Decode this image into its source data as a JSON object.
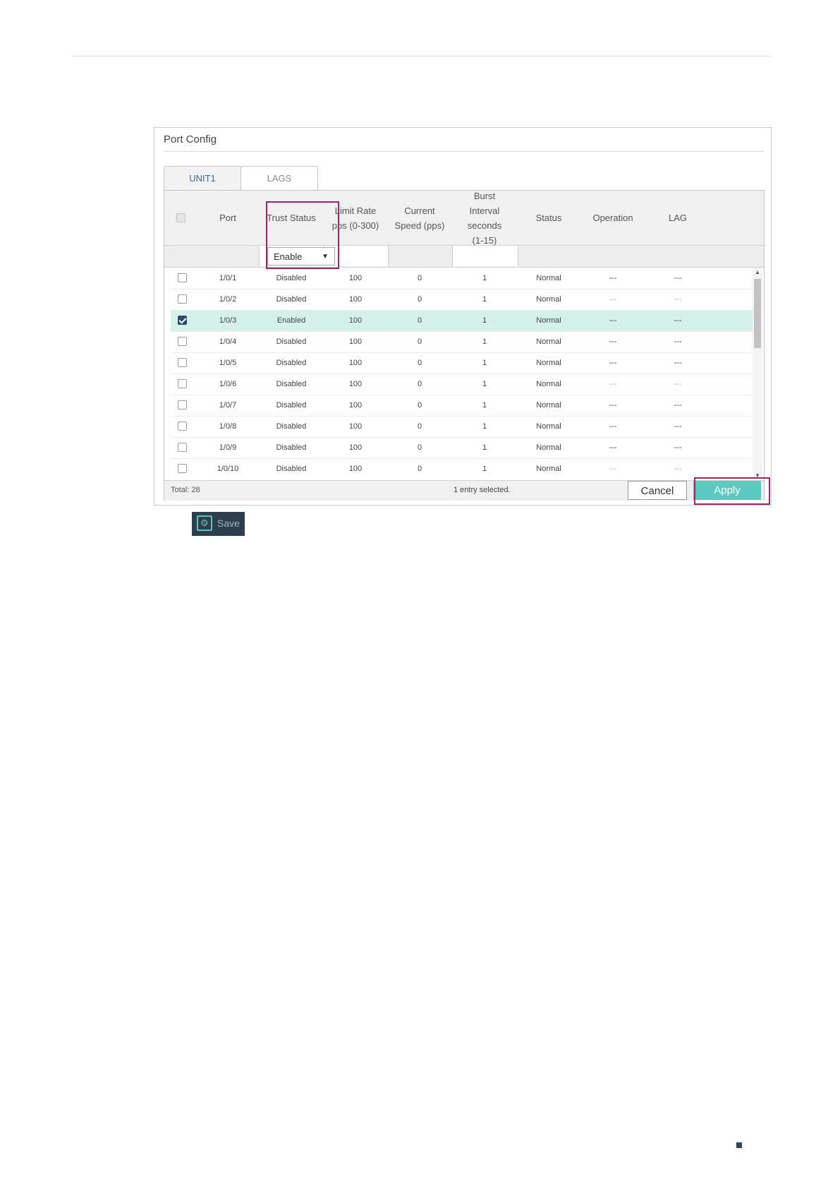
{
  "panel": {
    "title": "Port Config"
  },
  "tabs": [
    {
      "label": "UNIT1",
      "active": true
    },
    {
      "label": "LAGS",
      "active": false
    }
  ],
  "table": {
    "columns": {
      "port": "Port",
      "trust": "Trust Status",
      "limit": "Limit Rate pps (0-300)",
      "speed": "Current Speed (pps)",
      "burst": "Burst Interval seconds (1-15)",
      "status": "Status",
      "operation": "Operation",
      "lag": "LAG"
    },
    "filter": {
      "trust_select": "Enable"
    },
    "rows": [
      {
        "checked": false,
        "port": "1/0/1",
        "trust": "Disabled",
        "limit": "100",
        "speed": "0",
        "burst": "1",
        "status": "Normal",
        "operation": "---",
        "lag": "---",
        "dim": false
      },
      {
        "checked": false,
        "port": "1/0/2",
        "trust": "Disabled",
        "limit": "100",
        "speed": "0",
        "burst": "1",
        "status": "Normal",
        "operation": "---",
        "lag": "---",
        "dim": true
      },
      {
        "checked": true,
        "port": "1/0/3",
        "trust": "Enabled",
        "limit": "100",
        "speed": "0",
        "burst": "1",
        "status": "Normal",
        "operation": "---",
        "lag": "---",
        "dim": false
      },
      {
        "checked": false,
        "port": "1/0/4",
        "trust": "Disabled",
        "limit": "100",
        "speed": "0",
        "burst": "1",
        "status": "Normal",
        "operation": "---",
        "lag": "---",
        "dim": false
      },
      {
        "checked": false,
        "port": "1/0/5",
        "trust": "Disabled",
        "limit": "100",
        "speed": "0",
        "burst": "1",
        "status": "Normal",
        "operation": "---",
        "lag": "---",
        "dim": false
      },
      {
        "checked": false,
        "port": "1/0/6",
        "trust": "Disabled",
        "limit": "100",
        "speed": "0",
        "burst": "1",
        "status": "Normal",
        "operation": "---",
        "lag": "---",
        "dim": true
      },
      {
        "checked": false,
        "port": "1/0/7",
        "trust": "Disabled",
        "limit": "100",
        "speed": "0",
        "burst": "1",
        "status": "Normal",
        "operation": "---",
        "lag": "---",
        "dim": false
      },
      {
        "checked": false,
        "port": "1/0/8",
        "trust": "Disabled",
        "limit": "100",
        "speed": "0",
        "burst": "1",
        "status": "Normal",
        "operation": "---",
        "lag": "---",
        "dim": false
      },
      {
        "checked": false,
        "port": "1/0/9",
        "trust": "Disabled",
        "limit": "100",
        "speed": "0",
        "burst": "1",
        "status": "Normal",
        "operation": "---",
        "lag": "---",
        "dim": false
      },
      {
        "checked": false,
        "port": "1/0/10",
        "trust": "Disabled",
        "limit": "100",
        "speed": "0",
        "burst": "1",
        "status": "Normal",
        "operation": "---",
        "lag": "---",
        "dim": true
      }
    ],
    "footer": {
      "total": "Total: 28",
      "selected": "1 entry selected.",
      "cancel": "Cancel",
      "apply": "Apply"
    }
  },
  "toolbar": {
    "save_label": "Save"
  },
  "colors": {
    "accent": "#5cc9be",
    "highlight": "#a5236b",
    "selected_row": "#d6f0ec"
  },
  "icons": {
    "save": "save-gear-icon",
    "dropdown": "chevron-down-icon"
  }
}
